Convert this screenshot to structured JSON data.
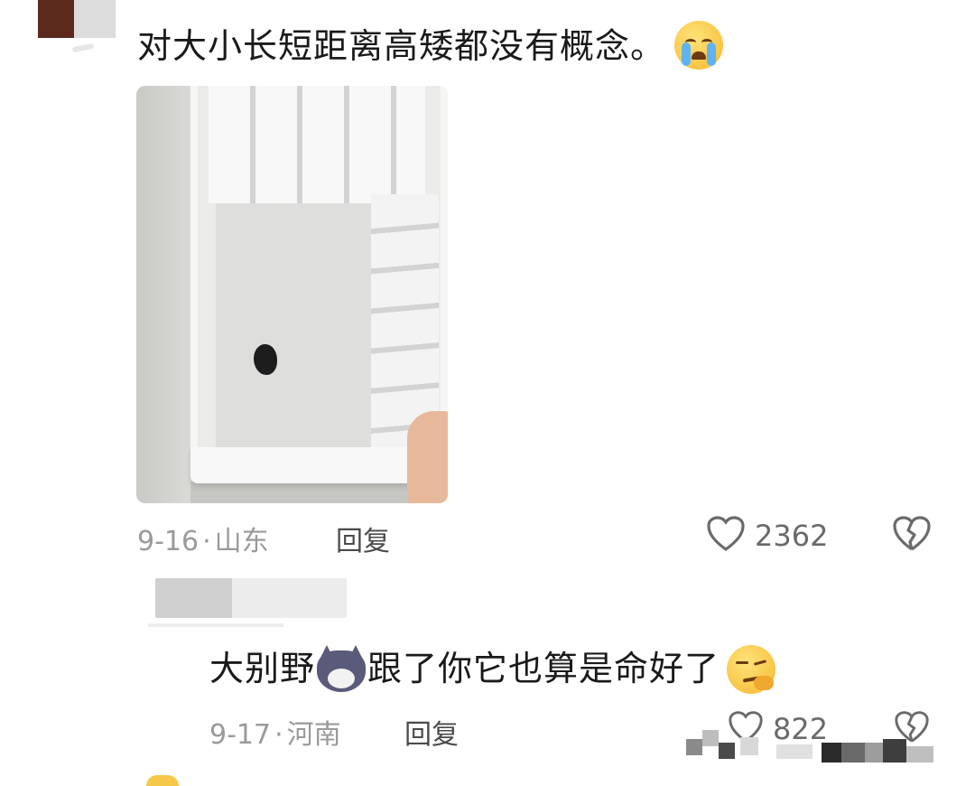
{
  "comment": {
    "text": "对大小长短距离高矮都没有概念。",
    "emoji": "loudly-crying-face",
    "date": "9-16",
    "location": "山东",
    "reply_label": "回复",
    "likes": "2362"
  },
  "reply": {
    "text_part1": "大别野",
    "text_part2": "跟了你它也算是命好了",
    "emojis": [
      "husky-dog-face",
      "smirk-face"
    ],
    "date": "9-17",
    "location": "河南",
    "reply_label": "回复",
    "likes": "822"
  },
  "colors": {
    "meta": "#9a9a9a",
    "text": "#1a1a1a",
    "icon": "#6a6a6a"
  }
}
